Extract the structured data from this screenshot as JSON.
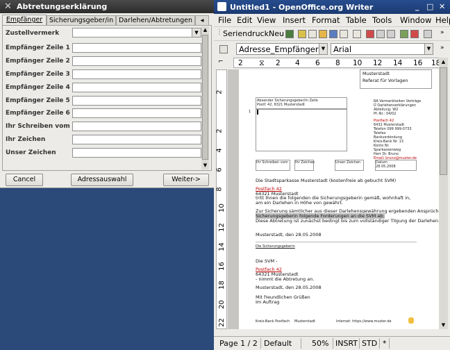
{
  "dialog": {
    "title": "Abtretungserklärung",
    "tabs": [
      "Empfänger",
      "Sicherungsgeber/in",
      "Darlehen/Abtretungen"
    ],
    "fields": [
      {
        "label": "Zustellvermerk",
        "value": ""
      },
      {
        "label": "Empfänger Zeile 1",
        "value": ""
      },
      {
        "label": "Empfänger Zeile 2",
        "value": ""
      },
      {
        "label": "Empfänger Zeile 3",
        "value": ""
      },
      {
        "label": "Empfänger Zeile 4",
        "value": ""
      },
      {
        "label": "Empfänger Zeile 5",
        "value": ""
      },
      {
        "label": "Empfänger Zeile 6",
        "value": ""
      },
      {
        "label": "Ihr Schreiben vom",
        "value": ""
      },
      {
        "label": "Ihr Zeichen",
        "value": ""
      },
      {
        "label": "Unser Zeichen",
        "value": ""
      }
    ],
    "buttons": {
      "cancel": "Cancel",
      "address": "Adressauswahl",
      "next": "Weiter->"
    }
  },
  "writer": {
    "title": "Untitled1 - OpenOffice.org Writer",
    "menu": [
      "File",
      "Edit",
      "View",
      "Insert",
      "Format",
      "Table",
      "Tools",
      "Window",
      "Help"
    ],
    "toolbar": {
      "mailmerge_label": "SeriendruckNeu"
    },
    "style_box": "Adresse_Empfänger",
    "font_box": "Arial",
    "ruler": [
      "2",
      "2",
      "4",
      "6",
      "8",
      "10",
      "12",
      "14",
      "16",
      "18"
    ],
    "vruler": [
      "2",
      "2",
      "4",
      "6",
      "8",
      "10",
      "12",
      "14",
      "16",
      "18",
      "20",
      "22"
    ],
    "status": {
      "page": "Page 1 / 2",
      "style": "Default",
      "zoom": "50%",
      "mode": "INSRT",
      "sel": "STD",
      "mod": "*"
    }
  },
  "document": {
    "top_right": [
      "Musterstadt",
      "Referat für Vorlagen"
    ],
    "sender_small": [
      "Absender Sicherungsgeber/in Zeile",
      "Postf. 42, 6321 Musterstadt"
    ],
    "right_block": [
      "RA Vermerkheiten Verträge",
      "Ü Darlehenserklärungen",
      "Abteilung: W2",
      "Pf.-Nr.: 04/02"
    ],
    "right_block2": [
      "Postfach 42",
      "6432 Musterstadt",
      "Telefon 099 999-0733",
      "Telefax",
      "Bankverbindung",
      "Kreis-Bank Nr. 13",
      "Konto Nr.",
      "Sparkassenweg",
      "Herr Dr. Bruno",
      "Email: bruno@muster.de"
    ],
    "ref_headers": [
      "Ihr Schreiben vom",
      "Ihr Zeichen",
      "Unser Zeichen",
      "Datum"
    ],
    "ref_date": "28.05.2008",
    "line_addr": "Die Stadtsparkasse Musterstadt (kostenfreie ab gebucht SVM)",
    "addr_block": [
      "Postfach 42",
      "64321 Musterstadt",
      "tritt Ihnen die folgenden die Sicherungsgeberin gemäß, wohnhaft in, am ein Darlehen in Höhe von gewährt."
    ],
    "para2": [
      "Zur Sicherung sämtlicher aus dieser Darlehensgewährung ergebenden Ansprüche tritt die",
      "Sicherungsgeberin folgende Forderungen an die SVM ab:",
      "Diese Abtretung ist zunächst bedingt bis zum vollständiger Tilgung der Darlehen."
    ],
    "place_date1": "Musterstadt, den 28.05.2008",
    "sign_label": "Die Sicherungsgeberin",
    "svm_block": [
      "Die SVM -",
      "Postfach 42",
      "64321 Musterstadt",
      "- nimmt die Abtretung an."
    ],
    "place_date2": "Musterstadt, den 28.05.2008",
    "closing": [
      "Mit freundlichen Grüßen",
      "Im Auftrag"
    ],
    "footer": [
      "Kreis-Bank Postfach",
      "Musterstadt",
      "Internet: https://www.muster.de"
    ]
  }
}
